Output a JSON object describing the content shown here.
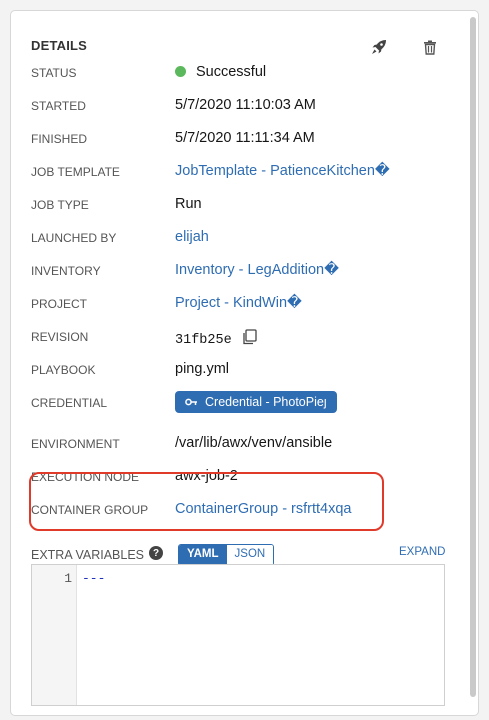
{
  "details": {
    "title": "DETAILS",
    "fields": [
      {
        "label": "STATUS",
        "value": "Successful"
      },
      {
        "label": "STARTED",
        "value": "5/7/2020 11:10:03 AM"
      },
      {
        "label": "FINISHED",
        "value": "5/7/2020 11:11:34 AM"
      },
      {
        "label": "JOB TEMPLATE",
        "value": "JobTemplate - PatienceKitchen�"
      },
      {
        "label": "JOB TYPE",
        "value": "Run"
      },
      {
        "label": "LAUNCHED BY",
        "value": "elijah"
      },
      {
        "label": "INVENTORY",
        "value": "Inventory - LegAddition�"
      },
      {
        "label": "PROJECT",
        "value": "Project - KindWin�"
      },
      {
        "label": "REVISION",
        "value": "31fb25e"
      },
      {
        "label": "PLAYBOOK",
        "value": "ping.yml"
      },
      {
        "label": "CREDENTIAL",
        "value": "Credential - PhotoPieȷ"
      },
      {
        "label": "ENVIRONMENT",
        "value": "/var/lib/awx/venv/ansible"
      },
      {
        "label": "EXECUTION NODE",
        "value": "awx-job-2"
      },
      {
        "label": "CONTAINER GROUP",
        "value": "ContainerGroup - rsfrtt4xqa"
      }
    ]
  },
  "extra_variables": {
    "label": "EXTRA VARIABLES",
    "help": "?",
    "toggle": [
      "YAML",
      "JSON"
    ],
    "active": "YAML",
    "expand_label": "EXPAND",
    "line_number": "1",
    "code": "---"
  },
  "colors": {
    "link": "#2f6db3",
    "success": "#5cb85c",
    "highlight": "#e03a2b"
  },
  "icons": [
    "rocket-icon",
    "trash-icon",
    "copy-icon",
    "key-icon",
    "help-icon"
  ]
}
